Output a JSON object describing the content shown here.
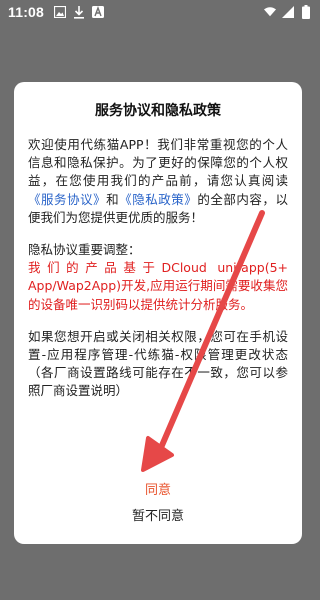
{
  "status_bar": {
    "time": "11:08",
    "left_icons": [
      "gallery-icon",
      "download-icon",
      "font-icon"
    ],
    "right_icons": [
      "wifi-icon",
      "signal-icon",
      "battery-icon"
    ]
  },
  "dialog": {
    "title": "服务协议和隐私政策",
    "p1": {
      "t1": "欢迎使用代练猫APP！我们非常重视您的个人信息和隐私保护。为了更好的保障您的个人权益，在您使用我们的产品前，请您认真阅读",
      "link1": "《服务协议》",
      "t2": "和",
      "link2": "《隐私政策》",
      "t3": "的全部内容，以便我们为您提供更优质的服务！"
    },
    "p2": {
      "heading": "隐私协议重要调整：",
      "red": "我们的产品基于DCloud uni-app(5+ App/Wap2App)开发,应用运行期间需要收集您的设备唯一识别码以提供统计分析服务。"
    },
    "p3": "如果您想开启或关闭相关权限，您可在手机设置-应用程序管理-代练猫-权限管理更改状态（各厂商设置路线可能存在不一致，您可以参照厂商设置说明）",
    "agree_label": "同意",
    "disagree_label": "暂不同意"
  },
  "colors": {
    "link": "#2a64c9",
    "notice_red": "#e02020",
    "agree": "#e8522b",
    "annotation_arrow": "#e64848",
    "backdrop": "#6e6e6e"
  }
}
